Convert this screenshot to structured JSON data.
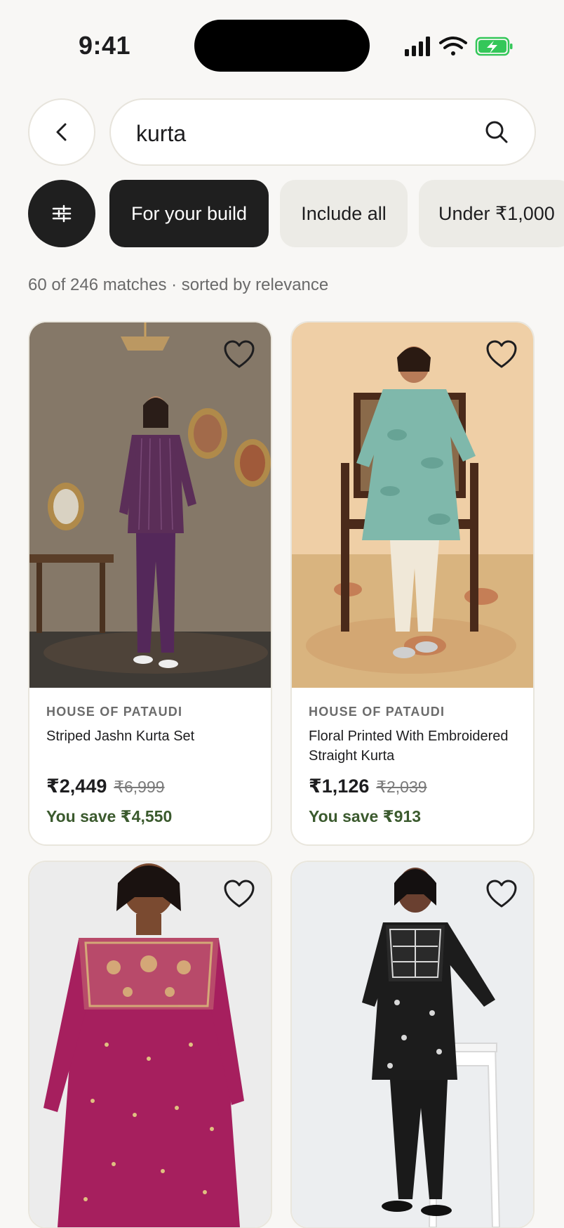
{
  "status": {
    "time": "9:41"
  },
  "search": {
    "query": "kurta"
  },
  "chips": [
    {
      "label": "For your build",
      "active": true
    },
    {
      "label": "Include all",
      "active": false
    },
    {
      "label": "Under ₹1,000",
      "active": false
    }
  ],
  "results": {
    "summary": "60 of 246 matches · sorted by relevance"
  },
  "products": [
    {
      "brand": "HOUSE OF PATAUDI",
      "name": "Striped Jashn Kurta Set",
      "price": "₹2,449",
      "mrp": "₹6,999",
      "save": "You save ₹4,550"
    },
    {
      "brand": "HOUSE OF PATAUDI",
      "name": "Floral Printed With Embroidered Straight Kurta",
      "price": "₹1,126",
      "mrp": "₹2,039",
      "save": "You save ₹913"
    },
    {
      "brand": "",
      "name": "",
      "price": "",
      "mrp": "",
      "save": ""
    },
    {
      "brand": "",
      "name": "",
      "price": "",
      "mrp": "",
      "save": ""
    }
  ],
  "colors": {
    "accent_dark": "#1f1f1f",
    "chip_light": "#ecebe6",
    "savings_green": "#3b5a2e",
    "battery_green": "#34c759"
  }
}
